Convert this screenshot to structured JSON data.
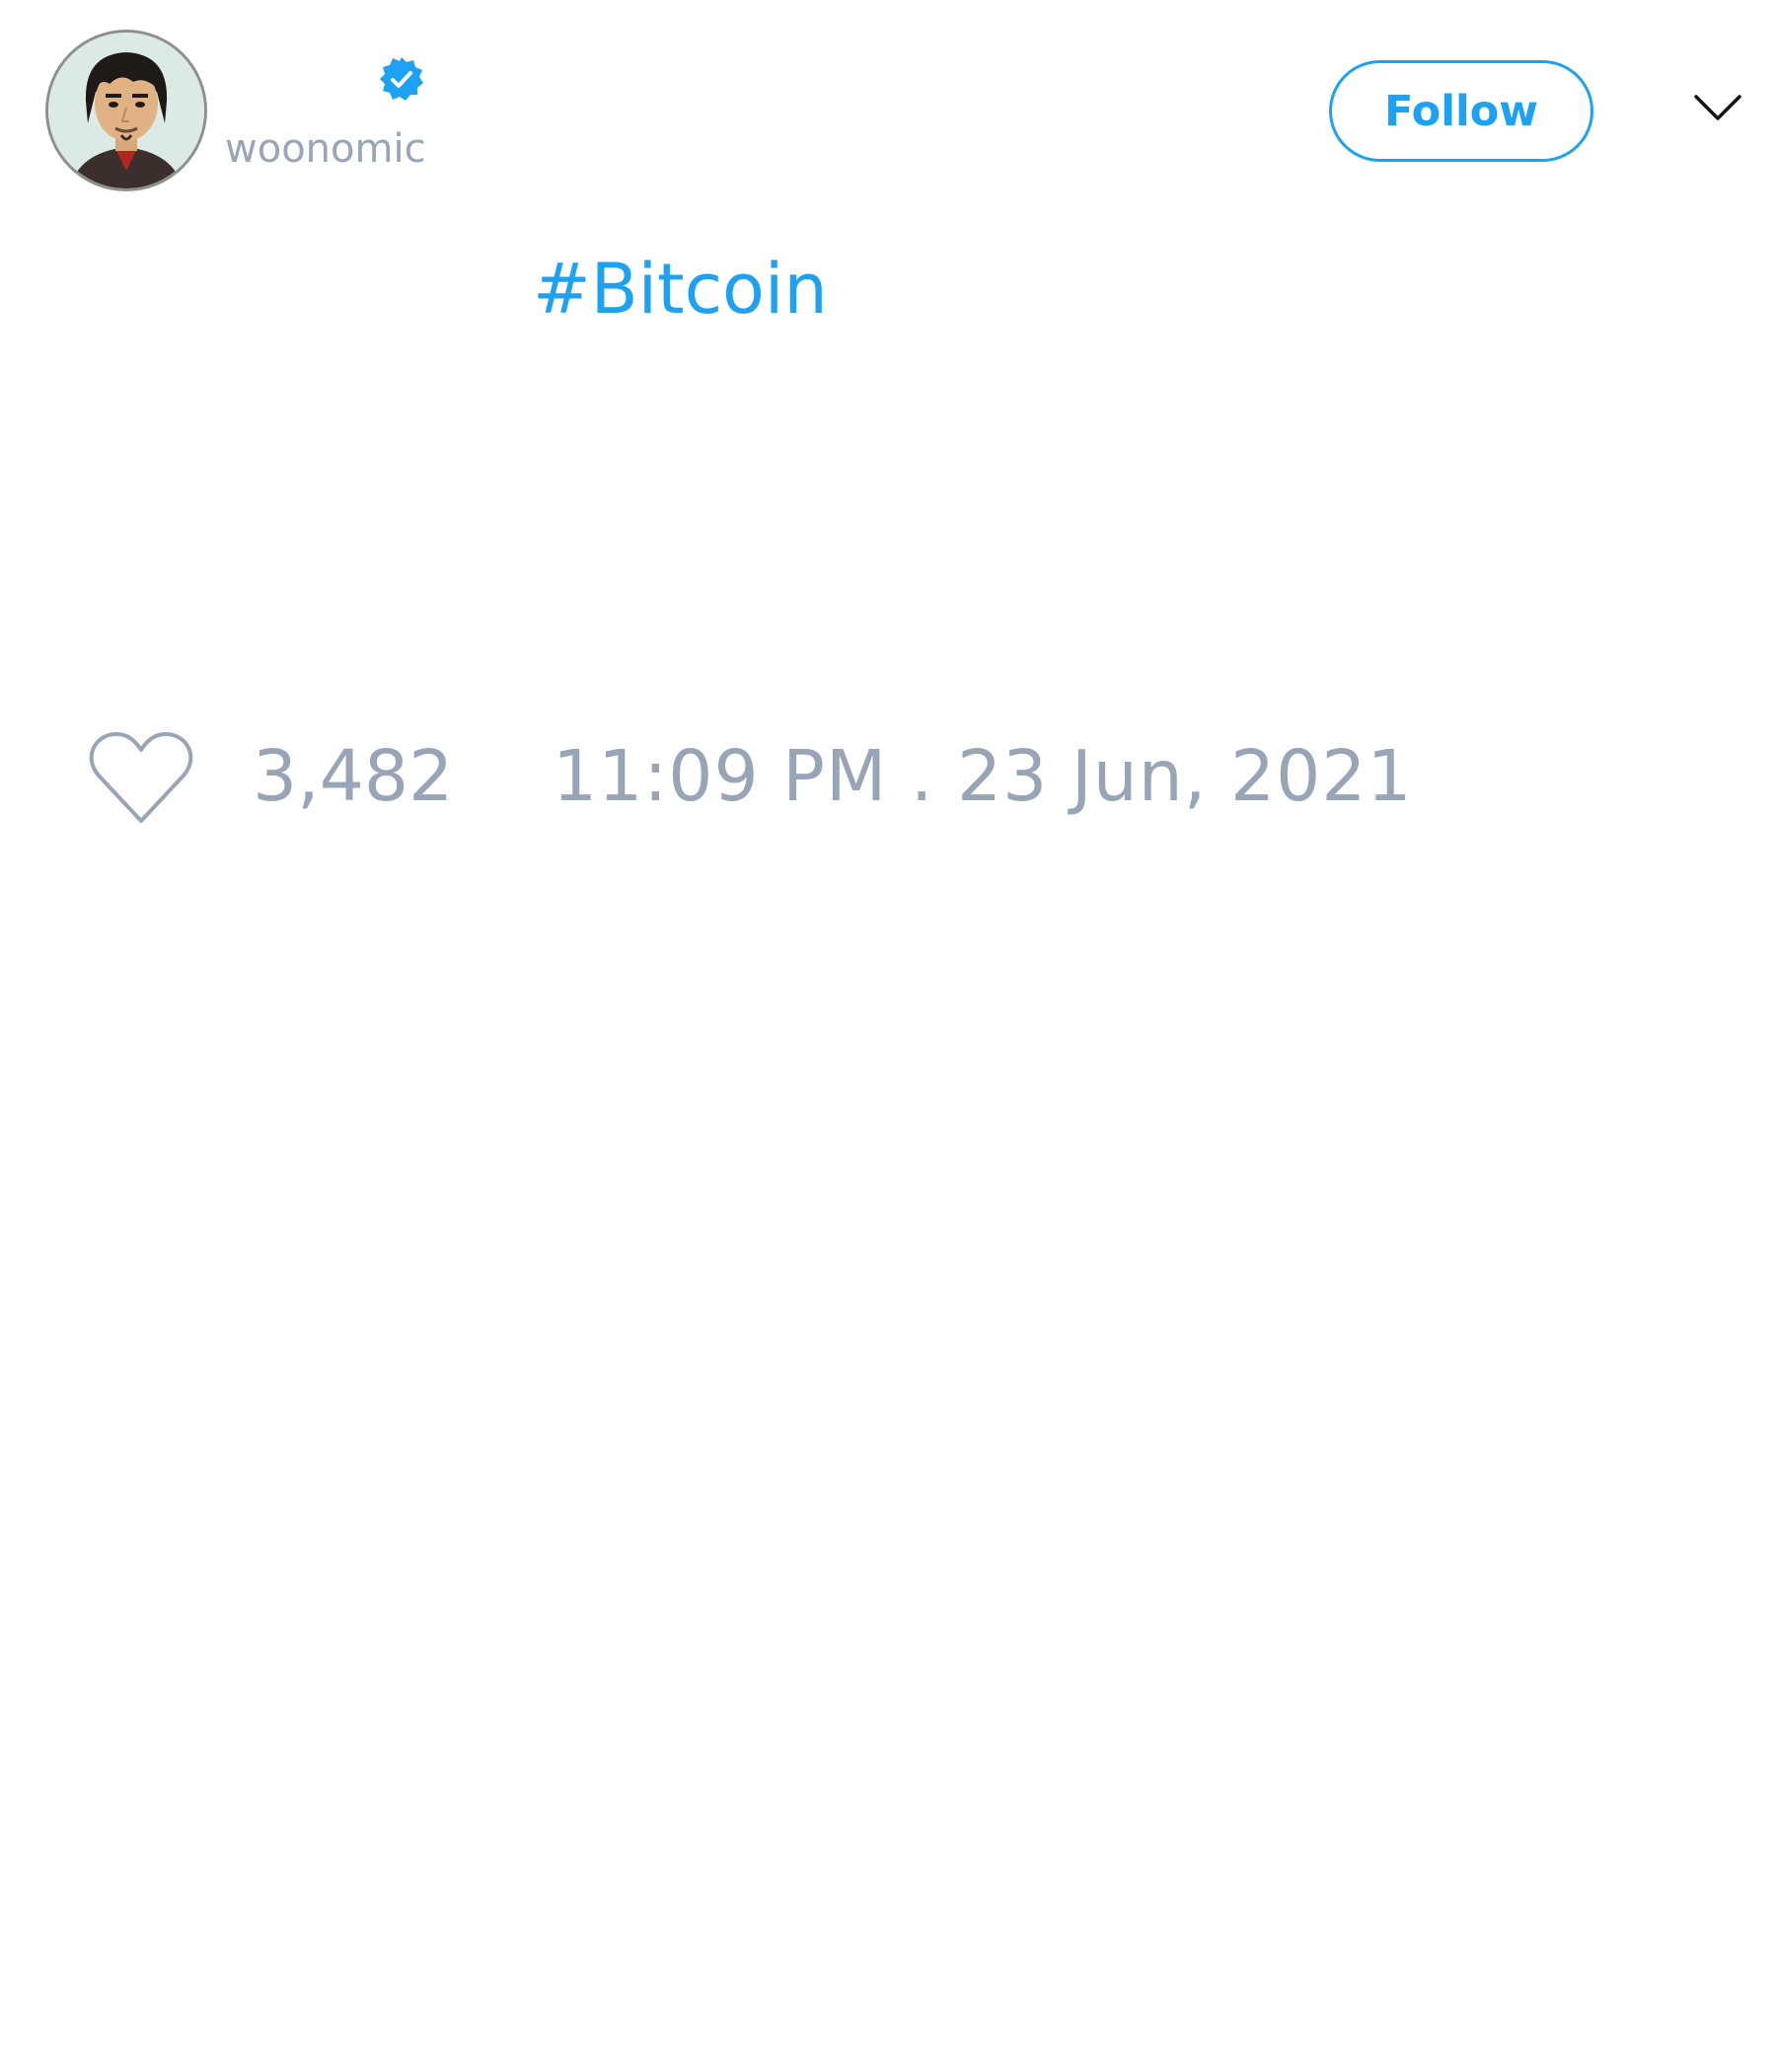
{
  "author": {
    "handle": "woonomic",
    "verified": true,
    "avatar_icon": "cartoon-avatar-icon"
  },
  "actions": {
    "follow_label": "Follow",
    "menu_icon": "chevron-down-icon"
  },
  "tweet": {
    "text": "#Bitcoin"
  },
  "stats": {
    "like_icon": "heart-icon",
    "likes": "3,482",
    "timestamp": "11:09 PM . 23 Jun, 2021"
  },
  "colors": {
    "accent": "#1da1f2",
    "muted_text": "#98a5b6",
    "background": "#ffffff"
  }
}
